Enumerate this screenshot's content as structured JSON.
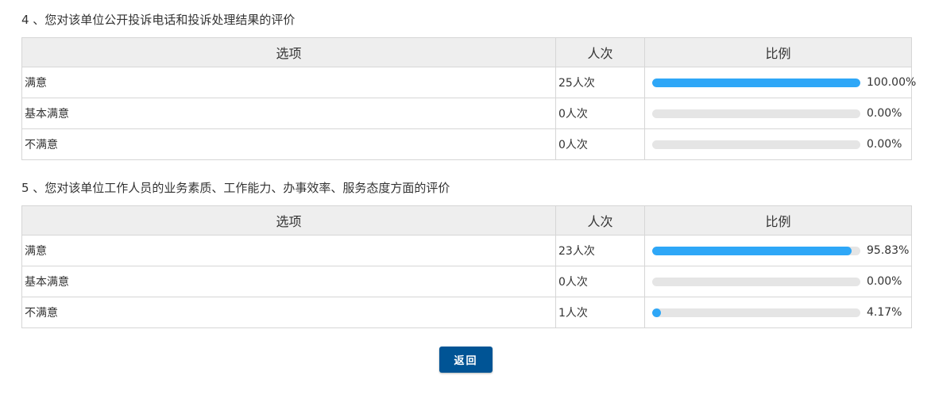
{
  "colors": {
    "bar_fill": "#2ea7f7",
    "bar_track": "#e5e5e5",
    "header_bg": "#eeeeee",
    "button_bg": "#005495"
  },
  "questions": [
    {
      "title": "4 、您对该单位公开投诉电话和投诉处理结果的评价",
      "headers": {
        "option": "选项",
        "count": "人次",
        "ratio": "比例"
      },
      "rows": [
        {
          "option": "满意",
          "count": "25人次",
          "percent": "100.00%",
          "fraction": 1.0
        },
        {
          "option": "基本满意",
          "count": "0人次",
          "percent": "0.00%",
          "fraction": 0.0
        },
        {
          "option": "不满意",
          "count": "0人次",
          "percent": "0.00%",
          "fraction": 0.0
        }
      ]
    },
    {
      "title": "5 、您对该单位工作人员的业务素质、工作能力、办事效率、服务态度方面的评价",
      "headers": {
        "option": "选项",
        "count": "人次",
        "ratio": "比例"
      },
      "rows": [
        {
          "option": "满意",
          "count": "23人次",
          "percent": "95.83%",
          "fraction": 0.9583
        },
        {
          "option": "基本满意",
          "count": "0人次",
          "percent": "0.00%",
          "fraction": 0.0
        },
        {
          "option": "不满意",
          "count": "1人次",
          "percent": "4.17%",
          "fraction": 0.0417
        }
      ]
    }
  ],
  "back_button": {
    "label": "返回"
  }
}
